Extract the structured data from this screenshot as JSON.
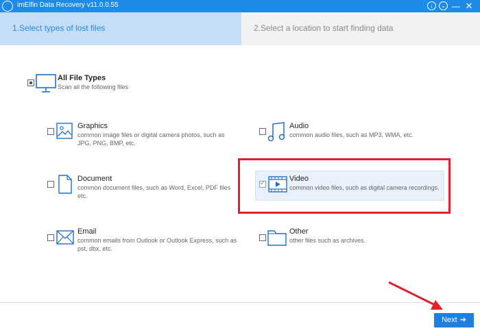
{
  "window": {
    "title": "imElfin Data Recovery v11.0.0.55",
    "controls": [
      "download",
      "menu",
      "minimize",
      "close"
    ]
  },
  "steps": [
    {
      "label": "1.Select types of lost files",
      "active": true
    },
    {
      "label": "2.Select a location to start finding data",
      "active": false
    }
  ],
  "all_types": {
    "title": "All File Types",
    "desc": "Scan all the following files",
    "state": "partial",
    "icon": "monitor-icon"
  },
  "types": {
    "graphics": {
      "title": "Graphics",
      "desc": "common image files or digital camera photos, such as JPG, PNG, BMP, etc.",
      "checked": false,
      "icon": "image-icon"
    },
    "audio": {
      "title": "Audio",
      "desc": "common audio files, such as MP3, WMA, etc.",
      "checked": false,
      "icon": "music-note-icon"
    },
    "document": {
      "title": "Document",
      "desc": "common document files, such as Word, Excel, PDF files etc.",
      "checked": false,
      "icon": "document-icon"
    },
    "video": {
      "title": "Video",
      "desc": "common video files, such as digital camera recordings.",
      "checked": true,
      "icon": "film-icon"
    },
    "email": {
      "title": "Email",
      "desc": "common emails from Outlook or Outlook Express, such as pst, dbx, etc.",
      "checked": false,
      "icon": "envelope-icon"
    },
    "other": {
      "title": "Other",
      "desc": "other files such as archives.",
      "checked": false,
      "icon": "folder-icon"
    }
  },
  "footer": {
    "next_label": "Next"
  },
  "colors": {
    "accent": "#1f8be6",
    "step_active_bg": "#c5ddf6",
    "annotation": "#e0202a"
  }
}
